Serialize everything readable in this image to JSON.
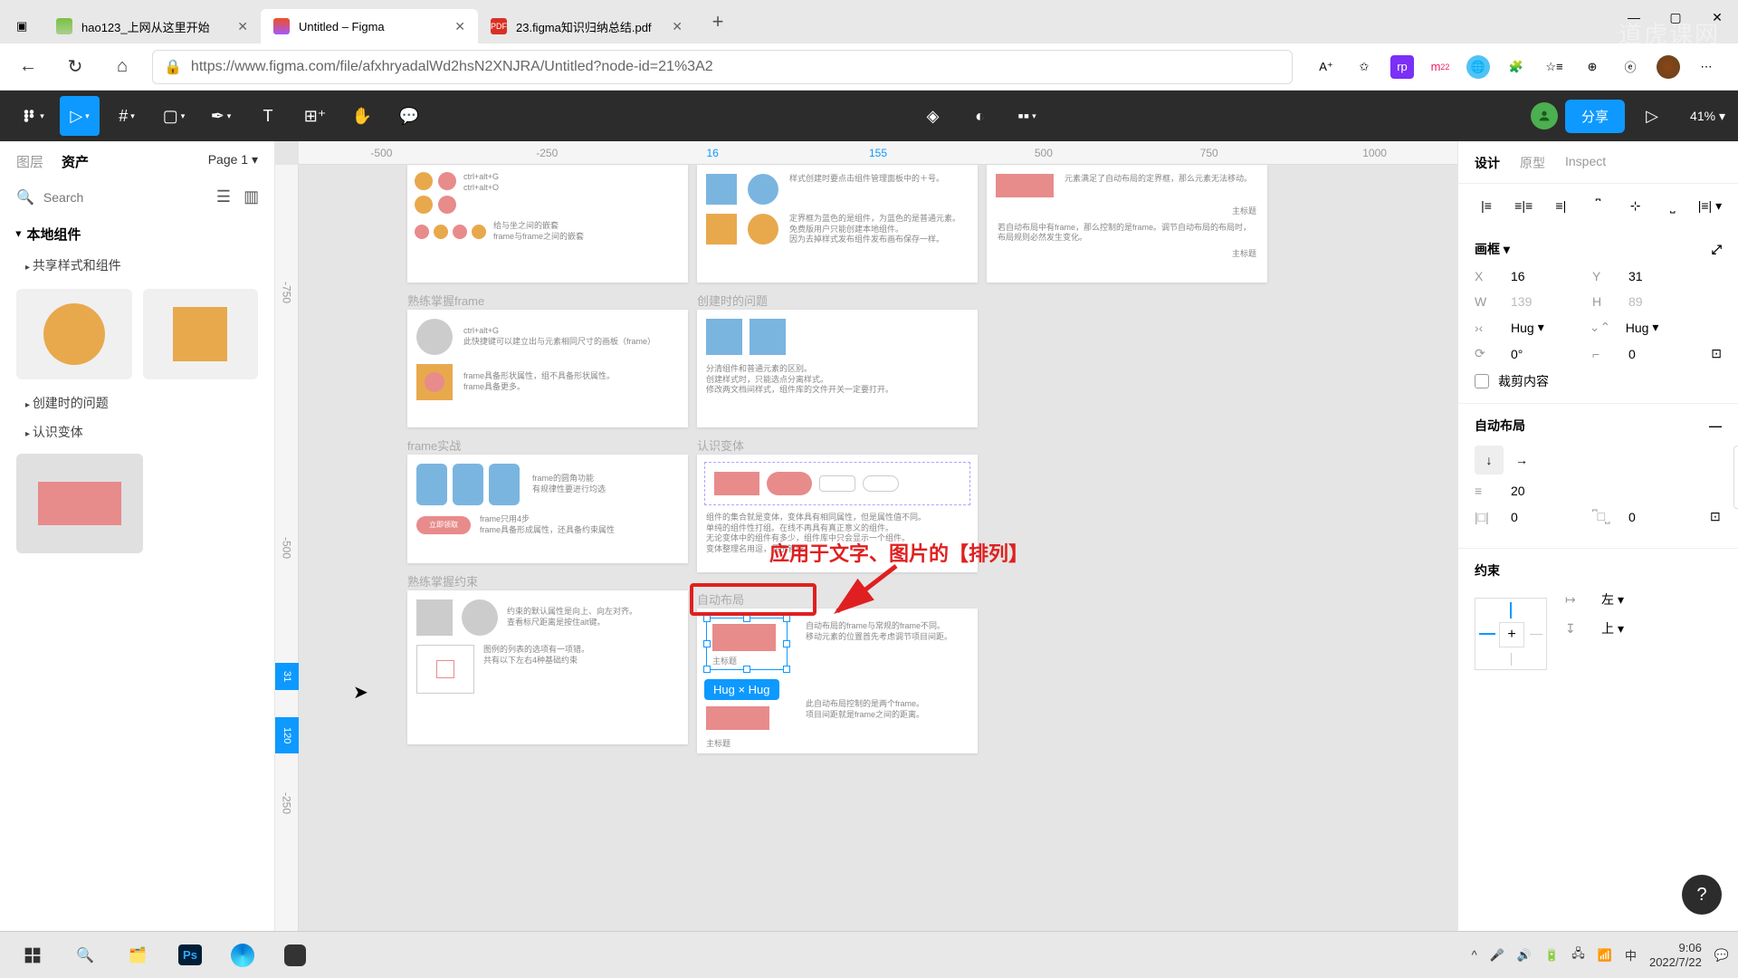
{
  "browser": {
    "tabs": [
      {
        "title": "hao123_上网从这里开始",
        "favicon": "hao"
      },
      {
        "title": "Untitled – Figma",
        "favicon": "figma",
        "active": true
      },
      {
        "title": "23.figma知识归纳总结.pdf",
        "favicon": "pdf"
      }
    ],
    "url": "https://www.figma.com/file/afxhryadalWd2hsN2XNJRA/Untitled?node-id=21%3A2"
  },
  "figma_toolbar": {
    "share": "分享",
    "zoom": "41%"
  },
  "left_panel": {
    "tab_layers": "图层",
    "tab_assets": "资产",
    "page": "Page 1",
    "search_placeholder": "Search",
    "section_local": "本地组件",
    "subsection_shared": "共享样式和组件",
    "subsection_create": "创建时的问题",
    "subsection_variant": "认识变体"
  },
  "ruler_h": [
    "-500",
    "-250",
    "16",
    "155",
    "500",
    "750",
    "1000"
  ],
  "ruler_v": [
    "-750",
    "-500",
    "-250"
  ],
  "ruler_v_highlight": [
    "31",
    "120"
  ],
  "canvas": {
    "annotation": "应用于文字、图片的【排列】",
    "size_badge": "Hug × Hug",
    "frame_titles": {
      "f1": "熟练掌握frame",
      "f2": "创建时的问题",
      "f3": "frame实战",
      "f4": "认识变体",
      "f5": "熟练掌握约束",
      "f6": "自动布局"
    },
    "snippets": {
      "s1": "ctrl+alt+G",
      "s2": "ctrl+alt+O",
      "s3": "给与坐之间的嵌套",
      "s4": "frame与frame之间的嵌套",
      "s5": "ctrl+alt+G",
      "s6": "此快捷键可以建立出与元素相同尺寸的画板（frame）",
      "s7": "frame具备形状属性，组不具备形状属性。",
      "s7b": "frame具备更多。",
      "s8": "frame的圆角功能",
      "s9": "有规律性要进行均选",
      "s10": "frame只用4步",
      "s11": "frame具备形成属性，还具备约束属性",
      "s12": "立即领取",
      "s13": "约束的默认属性是向上、向左对齐。",
      "s13b": "查看标尺距离是按住alt键。",
      "s14": "图例的列表的选项有一项错。",
      "s15": "共有以下左右4种基础约束",
      "s16": "样式创建时要点击组件管理面板中的＋号。",
      "s17": "定界框为蓝色的是组件，为蓝色的是普通元素。",
      "s18": "免费版用户只能创建本地组件。",
      "s19": "因为去掉样式发布组件发布画布保存一样。",
      "s20": "分清组件和普通元素的区别。",
      "s21": "创建样式时，只能选点分离样式。",
      "s22": "修改两文档间样式，组件库的文件开关一定要打开。",
      "s23": "组件的集合就是变体，变体具有相同属性，但是属性值不同。",
      "s24": "单纯的组件性打组。在线不再具有真正意义的组件。",
      "s25": "无论变体中的组件有多少，组件库中只会显示一个组件。",
      "s26": "变体整理名用逗，便于管理。",
      "s27": "自动布局的frame与常规的frame不同。",
      "s28": "移动元素的位置首先考虑调节项目间距。",
      "s29": "此自动布局控制的是两个frame。",
      "s30": "项目间距就是frame之间的距离。",
      "s31": "主标题",
      "s32": "主标题",
      "s33": "主标题",
      "s34": "主标题",
      "s35": "元素满足了自动布局的定界框，那么元素无法移动。",
      "s36": "若自动布局中有frame，那么控制的是frame。调节自动布局的布局时，布局规则必然发生变化。"
    }
  },
  "right_panel": {
    "tab_design": "设计",
    "tab_proto": "原型",
    "tab_inspect": "Inspect",
    "section_frame": "画框",
    "x_label": "X",
    "x_val": "16",
    "y_label": "Y",
    "y_val": "31",
    "w_label": "W",
    "w_val": "139",
    "h_label": "H",
    "h_val": "89",
    "hug": "Hug",
    "angle": "0°",
    "corner": "0",
    "clip": "裁剪内容",
    "section_autolayout": "自动布局",
    "gap": "20",
    "padding": "0",
    "padding2": "0",
    "section_constraint": "约束",
    "constraint_h": "左",
    "constraint_v": "上"
  },
  "taskbar": {
    "time": "9:06",
    "date": "2022/7/22",
    "ime": "中"
  },
  "watermark": "道虎课网"
}
